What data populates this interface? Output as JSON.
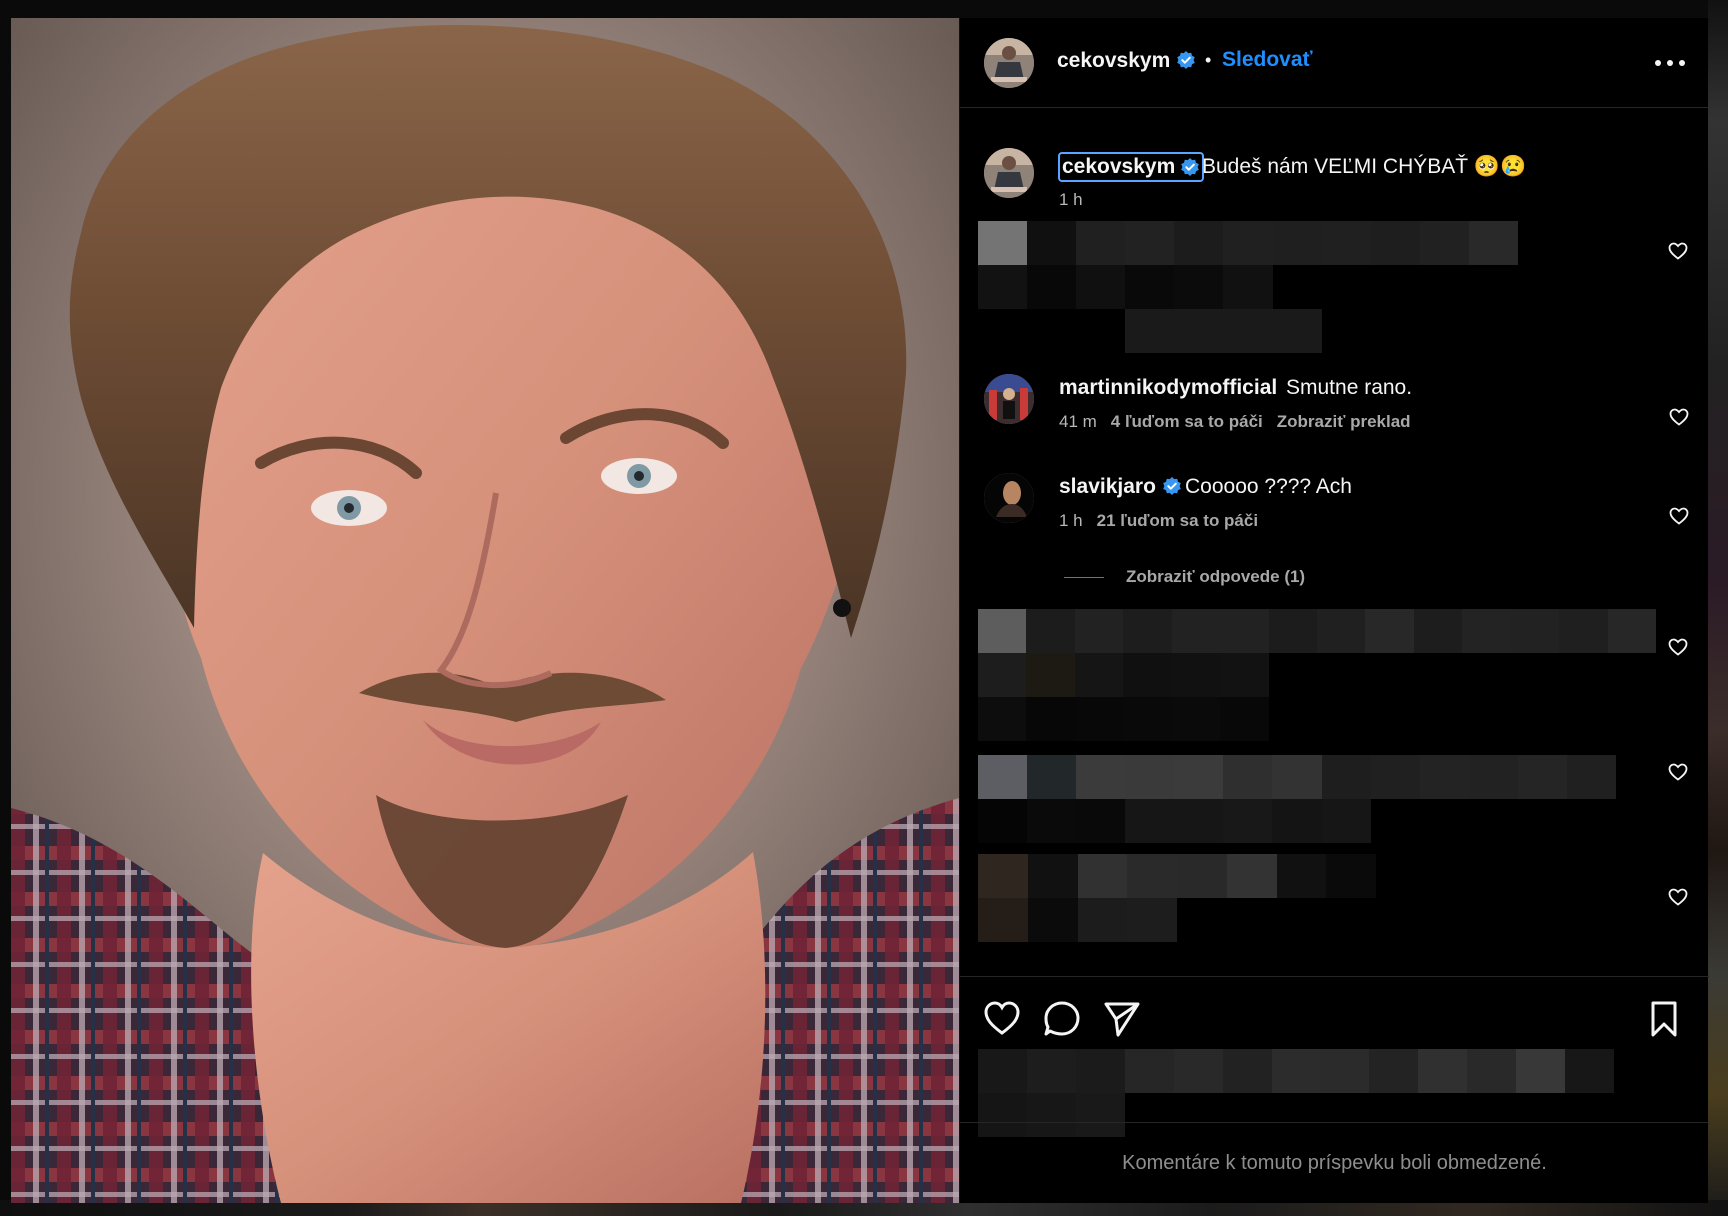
{
  "post": {
    "username": "cekovskym",
    "follow_label": "Sledovať",
    "more_icon": "more-horizontal-icon",
    "caption": "Budeš nám VEĽMI CHÝBAŤ 🥺😢",
    "caption_time": "1 h"
  },
  "comments": [
    {
      "username": "martinnikodymofficial",
      "text": "Smutne rano.",
      "time": "41 m",
      "likes": "4 ľuďom sa to páči",
      "action": "Zobraziť preklad"
    },
    {
      "username": "slavikjaro",
      "text": "Cooooo ???? Ach",
      "time": "1 h",
      "likes": "21 ľuďom sa to páči",
      "replies": "Zobraziť odpovede (1)"
    }
  ],
  "footer": {
    "restricted": "Komentáre k tomuto príspevku boli obmedzené."
  },
  "icons": {
    "like": "heart-icon",
    "comment": "comment-icon",
    "share": "send-icon",
    "save": "bookmark-icon"
  },
  "colors": {
    "background": "#000000",
    "accent": "#1f8fff",
    "verified": "#3797f0",
    "muted": "#a8a8a8"
  }
}
